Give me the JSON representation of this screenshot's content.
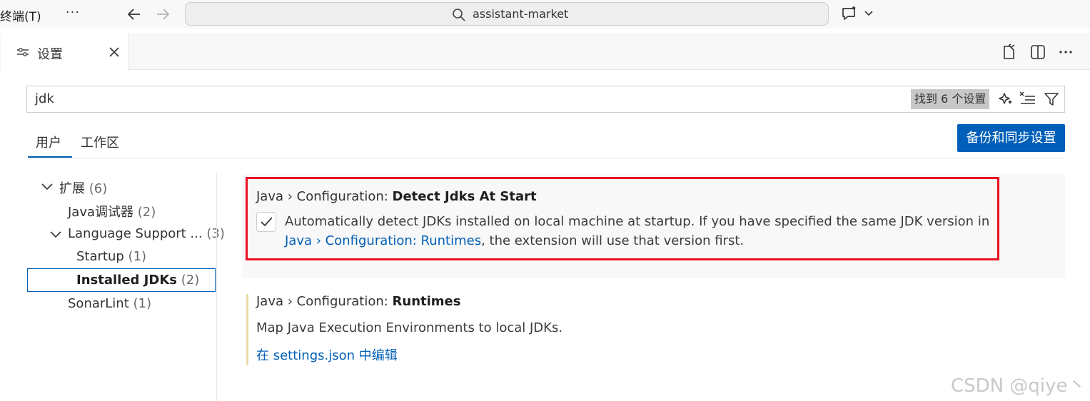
{
  "titlebar": {
    "menu_terminal": "终端(T)",
    "more_label": "···",
    "command_center_text": "assistant-market",
    "icons": [
      "more-icon",
      "arrow-left-icon",
      "arrow-right-icon",
      "search-icon",
      "chat-sparkle-icon",
      "chevron-down-icon"
    ]
  },
  "editor_tab": {
    "label": "设置",
    "icons": [
      "settings-sliders-icon",
      "close-icon"
    ],
    "toolbar_icons": [
      "open-json-icon",
      "split-editor-icon",
      "more-actions-icon"
    ]
  },
  "search": {
    "value": "jdk",
    "found_text": "找到 6 个设置",
    "icons": [
      "sparkle-icon",
      "clear-filter-icon",
      "filter-icon"
    ]
  },
  "scope_tabs": {
    "user": "用户",
    "workspace": "工作区",
    "active": "user"
  },
  "sync_button": "备份和同步设置",
  "toc": {
    "extensions": {
      "label": "扩展",
      "count": "(6)"
    },
    "java_debugger": {
      "label": "Java调试器",
      "count": "(2)"
    },
    "language_support": {
      "label": "Language Support ...",
      "count": "(3)"
    },
    "startup": {
      "label": "Startup",
      "count": "(1)"
    },
    "installed_jdks": {
      "label": "Installed JDKs",
      "count": "(2)"
    },
    "sonarlint": {
      "label": "SonarLint",
      "count": "(1)"
    },
    "selected": "installed_jdks"
  },
  "settings": [
    {
      "category": "Java › Configuration: ",
      "name": "Detect Jdks At Start",
      "checked": true,
      "desc_part1": "Automatically detect JDKs installed on local machine at startup. If you have specified the same JDK version in ",
      "desc_link": "Java › Configuration: Runtimes",
      "desc_part2": ", the extension will use that version first."
    },
    {
      "category": "Java › Configuration: ",
      "name": "Runtimes",
      "description": "Map Java Execution Environments to local JDKs.",
      "edit_link": "在 settings.json 中编辑"
    }
  ],
  "watermark": "CSDN @qiye丶",
  "colors": {
    "accent": "#005fb8",
    "highlight_border": "#e81123",
    "modified_bar": "#e8dcaa"
  }
}
